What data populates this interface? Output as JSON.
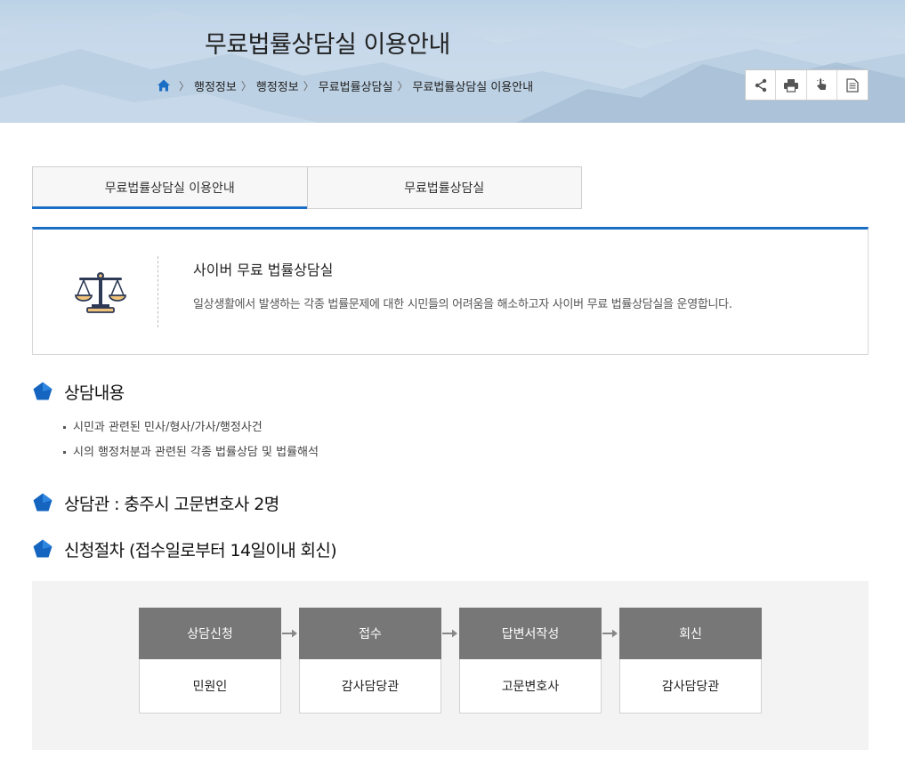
{
  "header": {
    "title": "무료법률상담실 이용안내",
    "breadcrumb": [
      "행정정보",
      "행정정보",
      "무료법률상담실",
      "무료법률상담실 이용안내"
    ],
    "tools": [
      "share-icon",
      "print-icon",
      "touch-icon",
      "document-icon"
    ]
  },
  "tabs": [
    {
      "label": "무료법률상담실 이용안내",
      "active": true
    },
    {
      "label": "무료법률상담실",
      "active": false
    }
  ],
  "intro": {
    "title": "사이버 무료 법률상담실",
    "description": "일상생활에서 발생하는 각종 법률문제에 대한 시민들의 어려움을 해소하고자 사이버 무료 법률상담실을 운영합니다."
  },
  "sections": {
    "consult": {
      "heading": "상담내용",
      "items": [
        "시민과 관련된 민사/형사/가사/행정사건",
        "시의 행정처분과 관련된 각종 법률상담 및 법률해석"
      ]
    },
    "counselor": {
      "heading": "상담관 : 충주시 고문변호사 2명"
    },
    "procedure": {
      "heading": "신청절차 (접수일로부터 14일이내 회신)"
    }
  },
  "process": [
    {
      "step": "상담신청",
      "actor": "민원인"
    },
    {
      "step": "접수",
      "actor": "감사담당관"
    },
    {
      "step": "답변서작성",
      "actor": "고문변호사"
    },
    {
      "step": "회신",
      "actor": "감사담당관"
    }
  ],
  "colors": {
    "accent": "#1a6ec5",
    "step_header": "#777777",
    "process_bg": "#f3f3f3"
  }
}
